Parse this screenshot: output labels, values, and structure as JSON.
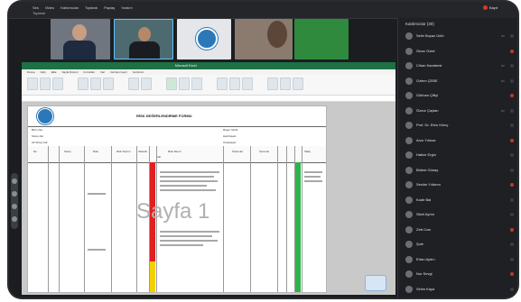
{
  "window": {
    "menu": [
      "Ses",
      "Video",
      "Katılımcılar",
      "Toplantı",
      "Paylaş",
      "Yardım"
    ],
    "title": "Toplantı",
    "recording_label": "Kayıt"
  },
  "watermark": "Sayfa 1",
  "participants_panel": {
    "title": "Katılımcılar (30)",
    "participants": [
      "Selin Boyaz Ünlü",
      "Ömer Öztel",
      "Cihan Kandemir",
      "Ozlem ÇEBE",
      "Gökhan Çiftçi",
      "Öznur Çaylan",
      "Prof. Dr. Ebru Kılınç",
      "Arzu Yılmaz",
      "Hatice Ergin",
      "Bülent Günay",
      "Serdar Yıldırım",
      "Kadir Bal",
      "Sibel Aydın",
      "Zeki Can",
      "Şule",
      "Ertan Aydın",
      "Nur Sevgi",
      "Selim Kaya"
    ]
  },
  "excel": {
    "title_bar": "Microsoft Excel",
    "tabs": [
      "Dosya",
      "Giriş",
      "Ekle",
      "Sayfa Düzeni",
      "Formüller",
      "Veri",
      "Gözden Geçir",
      "Görünüm"
    ],
    "page_title": "RİSK DEĞERLENDİRME FORMU",
    "info_left": [
      "Birim Adı:",
      "Süreç Adı:",
      "Alt Süreç Adı:"
    ],
    "info_right": [
      "Rapor Tarihi:",
      "Hazırlayan:",
      "Onaylayan:"
    ],
    "headers": [
      "No",
      "Süreç",
      "Risk",
      "Risk Tanımı",
      "Olasılık",
      "Etki",
      "Risk Skoru",
      "Önlemler",
      "Sorumlu",
      "Takip"
    ]
  },
  "colors": {
    "risk_high": "#e02020",
    "risk_medium": "#f2d000",
    "risk_low": "#2db34a",
    "excel_green": "#1e7145"
  }
}
